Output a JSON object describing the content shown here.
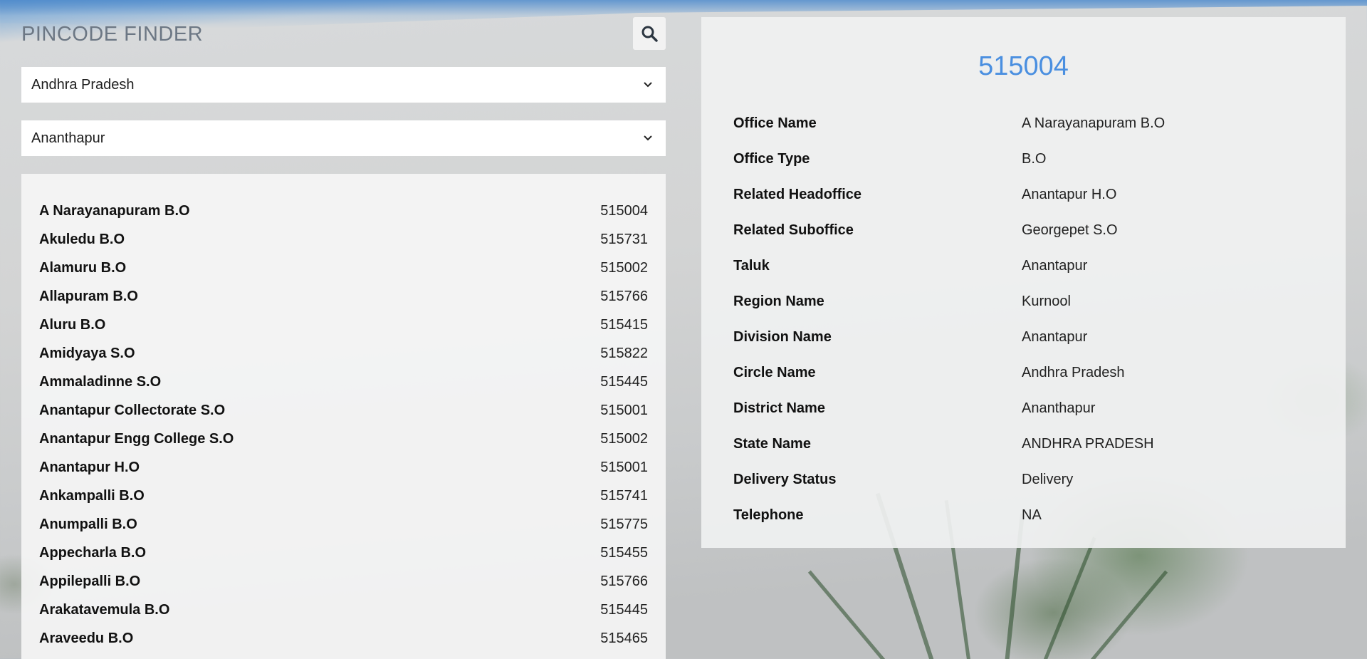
{
  "app": {
    "title": "PINCODE FINDER",
    "search_icon": "search-icon"
  },
  "filters": {
    "state": {
      "selected": "Andhra Pradesh",
      "icon": "chevron-down-icon"
    },
    "district": {
      "selected": "Ananthapur",
      "icon": "chevron-down-icon"
    }
  },
  "offices": [
    {
      "name": "A Narayanapuram B.O",
      "pincode": "515004"
    },
    {
      "name": "Akuledu B.O",
      "pincode": "515731"
    },
    {
      "name": "Alamuru B.O",
      "pincode": "515002"
    },
    {
      "name": "Allapuram B.O",
      "pincode": "515766"
    },
    {
      "name": "Aluru B.O",
      "pincode": "515415"
    },
    {
      "name": "Amidyaya S.O",
      "pincode": "515822"
    },
    {
      "name": "Ammaladinne S.O",
      "pincode": "515445"
    },
    {
      "name": "Anantapur Collectorate S.O",
      "pincode": "515001"
    },
    {
      "name": "Anantapur Engg College S.O",
      "pincode": "515002"
    },
    {
      "name": "Anantapur H.O",
      "pincode": "515001"
    },
    {
      "name": "Ankampalli B.O",
      "pincode": "515741"
    },
    {
      "name": "Anumpalli B.O",
      "pincode": "515775"
    },
    {
      "name": "Appecharla B.O",
      "pincode": "515455"
    },
    {
      "name": "Appilepalli B.O",
      "pincode": "515766"
    },
    {
      "name": "Arakatavemula B.O",
      "pincode": "515445"
    },
    {
      "name": "Araveedu B.O",
      "pincode": "515465"
    }
  ],
  "detail": {
    "pincode": "515004",
    "fields": [
      {
        "label": "Office Name",
        "value": "A Narayanapuram B.O"
      },
      {
        "label": "Office Type",
        "value": "B.O"
      },
      {
        "label": "Related Headoffice",
        "value": "Anantapur H.O"
      },
      {
        "label": "Related Suboffice",
        "value": "Georgepet S.O"
      },
      {
        "label": "Taluk",
        "value": "Anantapur"
      },
      {
        "label": "Region Name",
        "value": "Kurnool"
      },
      {
        "label": "Division Name",
        "value": "Anantapur"
      },
      {
        "label": "Circle Name",
        "value": "Andhra Pradesh"
      },
      {
        "label": "District Name",
        "value": "Ananthapur"
      },
      {
        "label": "State Name",
        "value": "ANDHRA PRADESH"
      },
      {
        "label": "Delivery Status",
        "value": "Delivery"
      },
      {
        "label": "Telephone",
        "value": "NA"
      }
    ]
  },
  "colors": {
    "accent": "#4a8fe0",
    "title": "#6c7784"
  }
}
